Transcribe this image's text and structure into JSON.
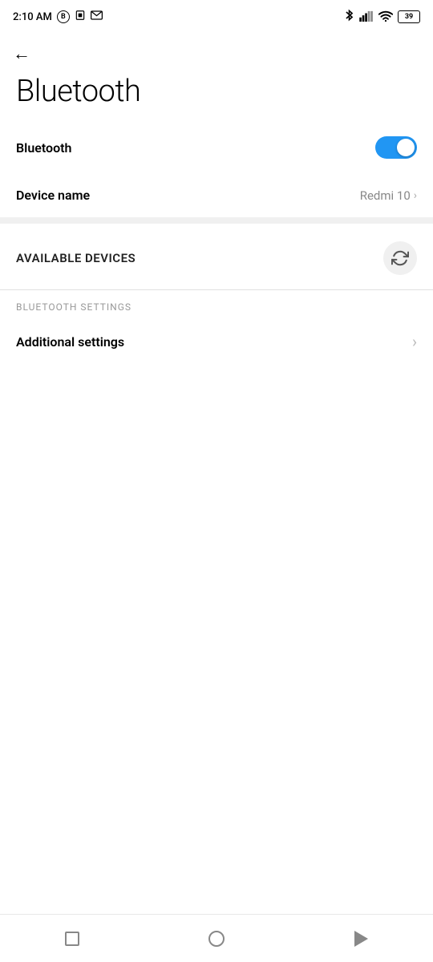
{
  "statusBar": {
    "time": "2:10 AM",
    "batteryLevel": "39",
    "icons": {
      "bluetooth": "bluetooth-icon",
      "signal": "signal-icon",
      "wifi": "wifi-icon",
      "battery": "battery-icon",
      "b_letter": "B",
      "sim": "sim-icon",
      "mail": "mail-icon"
    }
  },
  "header": {
    "backLabel": "←",
    "title": "Bluetooth"
  },
  "bluetoothSection": {
    "toggleLabel": "Bluetooth",
    "toggleEnabled": true,
    "deviceNameLabel": "Device name",
    "deviceNameValue": "Redmi 10"
  },
  "availableDevices": {
    "sectionLabel": "AVAILABLE DEVICES",
    "refreshTooltip": "Refresh"
  },
  "bluetoothSettings": {
    "sectionLabel": "BLUETOOTH SETTINGS",
    "additionalSettingsLabel": "Additional settings"
  },
  "navBar": {
    "squareLabel": "recent-apps-button",
    "circleLabel": "home-button",
    "triangleLabel": "back-button"
  }
}
